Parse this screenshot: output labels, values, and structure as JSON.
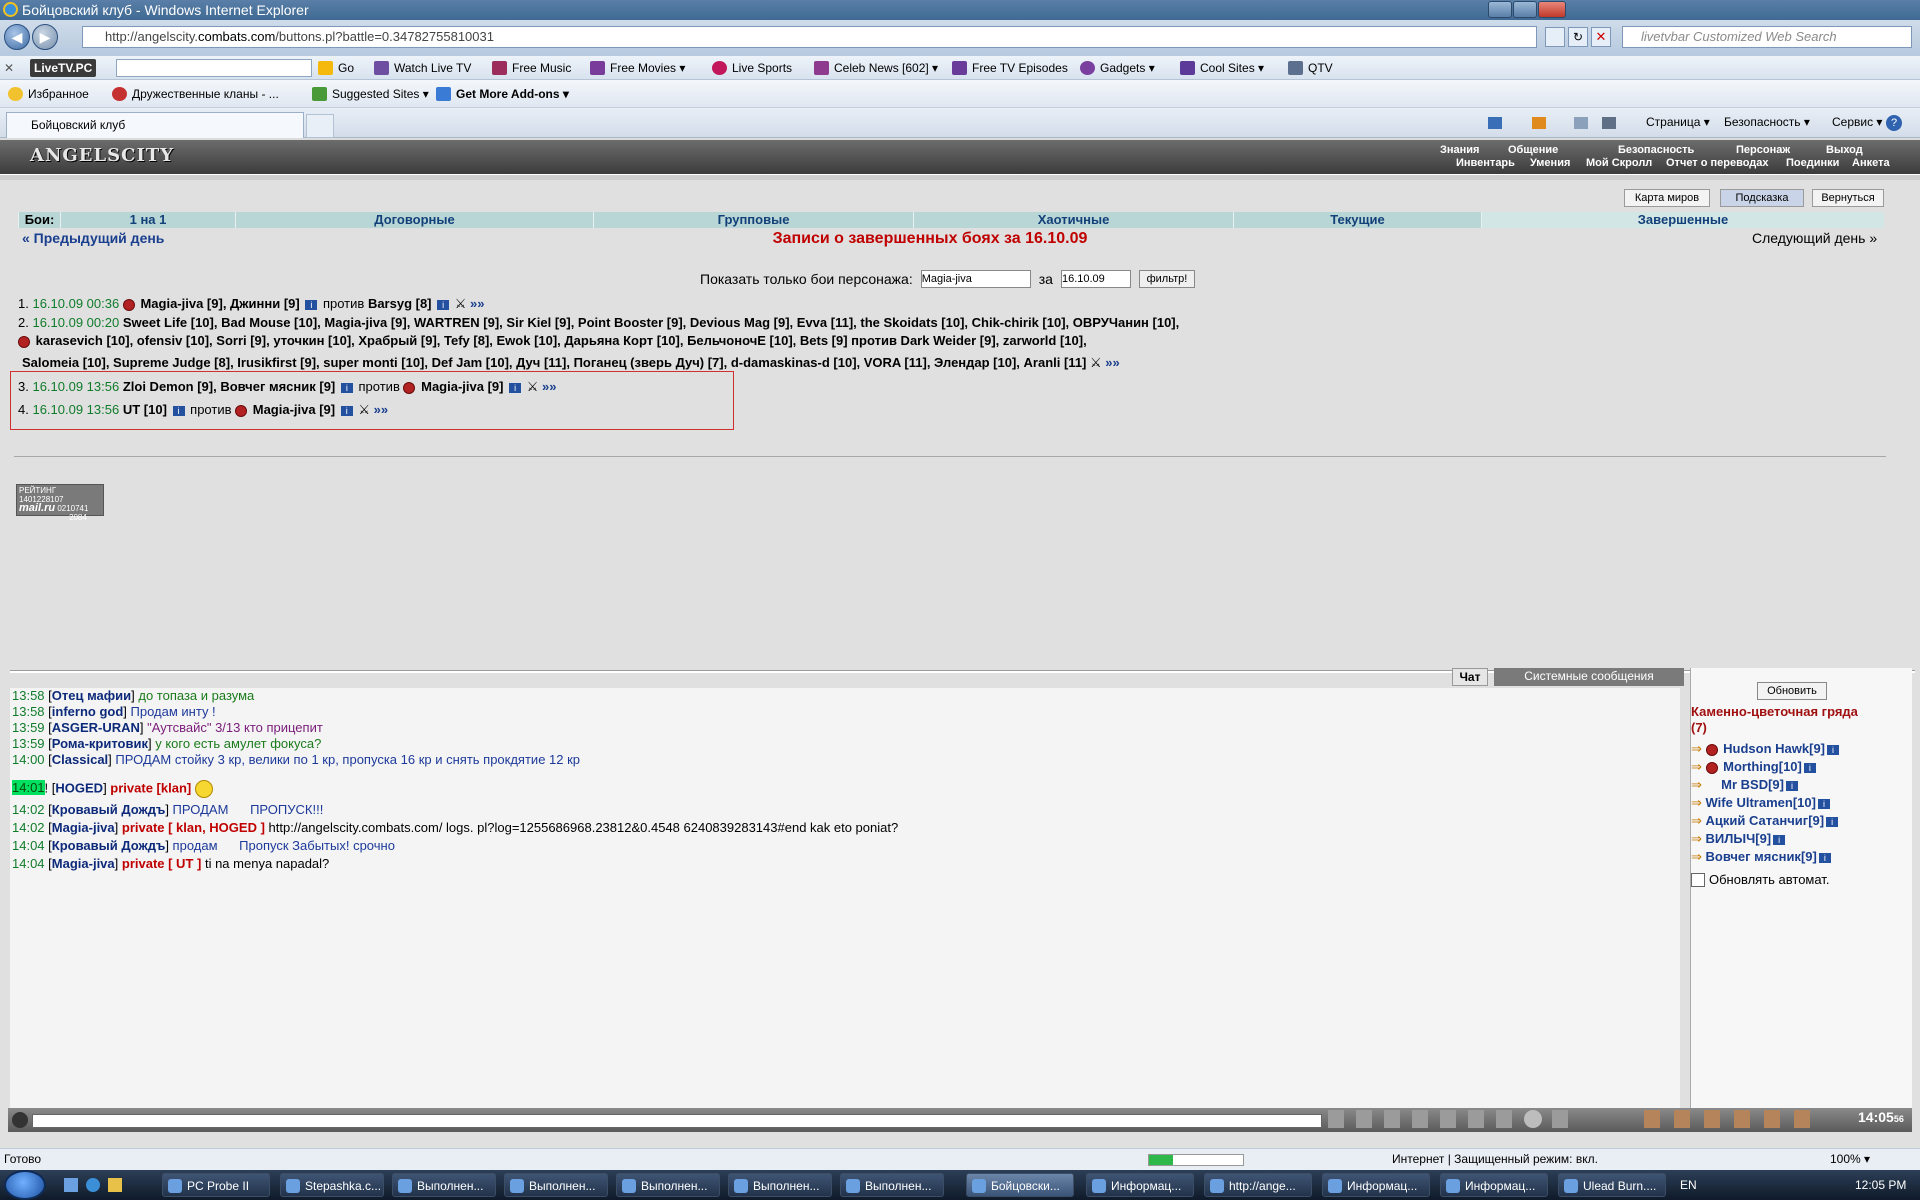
{
  "window": {
    "title": "Бойцовский клуб - Windows Internet Explorer",
    "url_prefix": "http://angelscity.",
    "url_host": "combats.com",
    "url_rest": "/buttons.pl?battle=0.34782755810031",
    "search_placeholder": "livetvbar Customized Web Search"
  },
  "toolbar": {
    "brand": "LiveTV.PC",
    "search_field_placeholder": "",
    "go": "Go",
    "items": [
      "Watch Live TV",
      "Free Music",
      "Free Movies",
      "Live Sports",
      "Celeb News [602]",
      "Free TV Episodes",
      "Gadgets",
      "Cool Sites",
      "QTV"
    ]
  },
  "favorites": {
    "fav": "Избранное",
    "items": [
      "Дружественные кланы - ...",
      "Suggested Sites",
      "Get More Add-ons"
    ]
  },
  "tabbar": {
    "tab": "Бойцовский клуб",
    "commands": [
      "Страница",
      "Безопасность",
      "Сервис"
    ]
  },
  "header": {
    "logo": "ANGELSCITY",
    "menu_top": [
      "Знания",
      "Общение",
      "Безопасность",
      "Персонаж",
      "Выход"
    ],
    "menu_bottom": [
      "Инвентарь",
      "Умения",
      "Мой Скролл",
      "Отчет о переводах",
      "Поединки",
      "Анкета"
    ]
  },
  "top_buttons": [
    "Карта миров",
    "Подсказка",
    "Вернуться"
  ],
  "fight_tabs": {
    "label": "Бои:",
    "items": [
      "1 на 1",
      "Договорные",
      "Групповые",
      "Хаотичные",
      "Текущие",
      "Завершенные"
    ]
  },
  "nav": {
    "prev": "« Предыдущий день",
    "title": "Записи о завершенных боях за 16.10.09",
    "next": "Следующий день »"
  },
  "filter": {
    "label": "Показать только бои персонажа:",
    "name_value": "Magia-jiva",
    "for": "за",
    "date_value": "16.10.09",
    "button": "фильтр!"
  },
  "fights": [
    {
      "n": "1.",
      "time": "16.10.09 00:36",
      "left": "Magia-jiva [9], Джинни [9]",
      "vs": "против",
      "right": "Barsyg [8]"
    },
    {
      "n": "2.",
      "time": "16.10.09 00:20",
      "line1": "Sweet Life [10], Bad Mouse [10], Magia-jiva [9], WARTREN [9], Sir Kiel [9], Point Booster [9], Devious Mag [9], Evva [11], the Skoidats [10], Chik-chirik [10], ОВРУЧанин [10],",
      "line2": "karasevich [10], ofensiv [10], Sorri [9], уточкин [10], Храбрый [9], Tefy [8], Ewok [10], Дарьяна Корт [10], БельчоночE [10], Bets [9] против Dark Weider [9], zarworld [10],",
      "line3": "Salomeia [10], Supreme Judge [8], Irusikfirst [9], super monti [10], Def Jam [10], Дуч [11], Поганец (зверь Дуч) [7], d-damaskinas-d [10], VORA [11], Элендар [10], Aranli [11]"
    },
    {
      "n": "3.",
      "time": "16.10.09 13:56",
      "left": "Zloi Demon [9], Вовчег мясник [9]",
      "vs": "против",
      "right": "Magia-jiva [9]"
    },
    {
      "n": "4.",
      "time": "16.10.09 13:56",
      "left": "UT [10]",
      "vs": "против",
      "right": "Magia-jiva [9]"
    }
  ],
  "fight_arrows": "»»",
  "counter": {
    "line1": "РЕЙТИНГ",
    "num1": "1401228107",
    "num2": "0210741",
    "num3": "2084",
    "brand": "mail.ru"
  },
  "chat_tabs": [
    "Чат",
    "Системные сообщения"
  ],
  "chat": [
    {
      "time": "13:58",
      "who": "Отец мафии",
      "text": "до топаза и разума",
      "cls": "msggreen"
    },
    {
      "time": "13:58",
      "who": "inferno god",
      "text": "Продам инту !",
      "cls": "msgblue"
    },
    {
      "time": "13:59",
      "who": "ASGER-URAN",
      "text": "\"Аутсвайс\" 3/13 кто прицепит",
      "cls": "msgpurple"
    },
    {
      "time": "13:59",
      "who": "Рома-критовик",
      "text": "у кого есть амулет фокуса?",
      "cls": "msggreen"
    },
    {
      "time": "14:00",
      "who": "Classical",
      "text": "ПРОДАМ стойку 3 кр, велики по 1 кр, пропуска 16 кр и снять прокдятие 12 кр",
      "cls": "msgblue"
    },
    {
      "time": "14:01",
      "who": "HOGED",
      "priv": "private [klan]",
      "text": "",
      "cls": "msgblue"
    },
    {
      "time": "14:02",
      "who": "Кровавый Дождъ",
      "text": "ПРОДАМ      ПРОПУСК!!!",
      "cls": "msgblue"
    },
    {
      "time": "14:02",
      "who": "Magia-jiva",
      "priv": "private [ klan, HOGED ]",
      "text": "http://angelscity.combats.com/ logs. pl?log=1255686968.23812&0.4548 6240839283143#end kak eto poniat?",
      "cls": "plain"
    },
    {
      "time": "14:04",
      "who": "Кровавый Дождъ",
      "text": "продам      Пропуск Забытых! срочно",
      "cls": "msgblue"
    },
    {
      "time": "14:04",
      "who": "Magia-jiva",
      "priv": "private [ UT ]",
      "text": "ti na menya napadal?",
      "cls": "plain"
    }
  ],
  "room": {
    "refresh": "Обновить",
    "name": "Каменно-цветочная гряда",
    "count": "(7)",
    "people": [
      "Hudson Hawk[9]",
      "Morthing[10]",
      "Mr BSD[9]",
      "Wife Ultramen[10]",
      "Ацкий Сатанчиг[9]",
      "ВИЛЫЧ[9]",
      "Вовчег мясник[9]"
    ],
    "auto": "Обновлять автомат."
  },
  "clock": "14:05",
  "clock_sec": "56",
  "statusbar": {
    "left": "Готово",
    "zone": "Интернет | Защищенный режим: вкл.",
    "zoom": "100%"
  },
  "taskbar": {
    "tasks": [
      "PC Probe II",
      "Stepashka.c...",
      "Выполнен...",
      "Выполнен...",
      "Выполнен...",
      "Выполнен...",
      "Выполнен...",
      "Бойцовски...",
      "Информац...",
      "http://ange...",
      "Информац...",
      "Информац...",
      "Ulead Burn...."
    ],
    "lang": "EN",
    "time": "12:05 PM"
  },
  "colors": {
    "accent_tab": "#b9d6d6",
    "title": "#c00000",
    "link": "#1a3f8e",
    "date": "#0f7c2a"
  }
}
